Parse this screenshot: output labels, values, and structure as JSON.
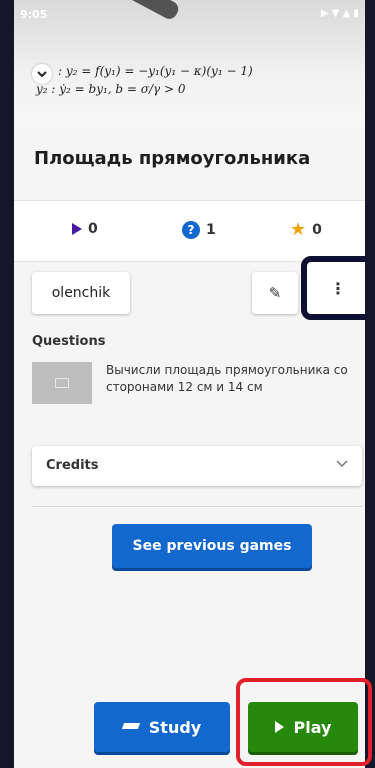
{
  "status": {
    "time": "9:05",
    "icons": "▶ ▼ ▲ ▮"
  },
  "header": {
    "formula_line1": ": y₂ = f(y₁) = −y₁(y₁ − κ)(y₁ − 1)",
    "formula_line2": "y₂ : ẏ₂ = by₁, b = σ/γ > 0"
  },
  "title": "Площадь прямоугольника",
  "stats": {
    "plays": "0",
    "questions": "1",
    "favorites": "0"
  },
  "author": {
    "name": "olenchik"
  },
  "questions": {
    "heading": "Questions",
    "items": [
      {
        "text": "Вычисли площадь прямоугольника со сторонами 12 см и 14 см"
      }
    ]
  },
  "credits": {
    "label": "Credits"
  },
  "buttons": {
    "previous_games": "See previous games",
    "study": "Study",
    "play": "Play"
  },
  "colors": {
    "primary": "#1368ce",
    "play": "#26890c",
    "highlight_red": "#e0202b",
    "highlight_navy": "#0d0f33"
  }
}
